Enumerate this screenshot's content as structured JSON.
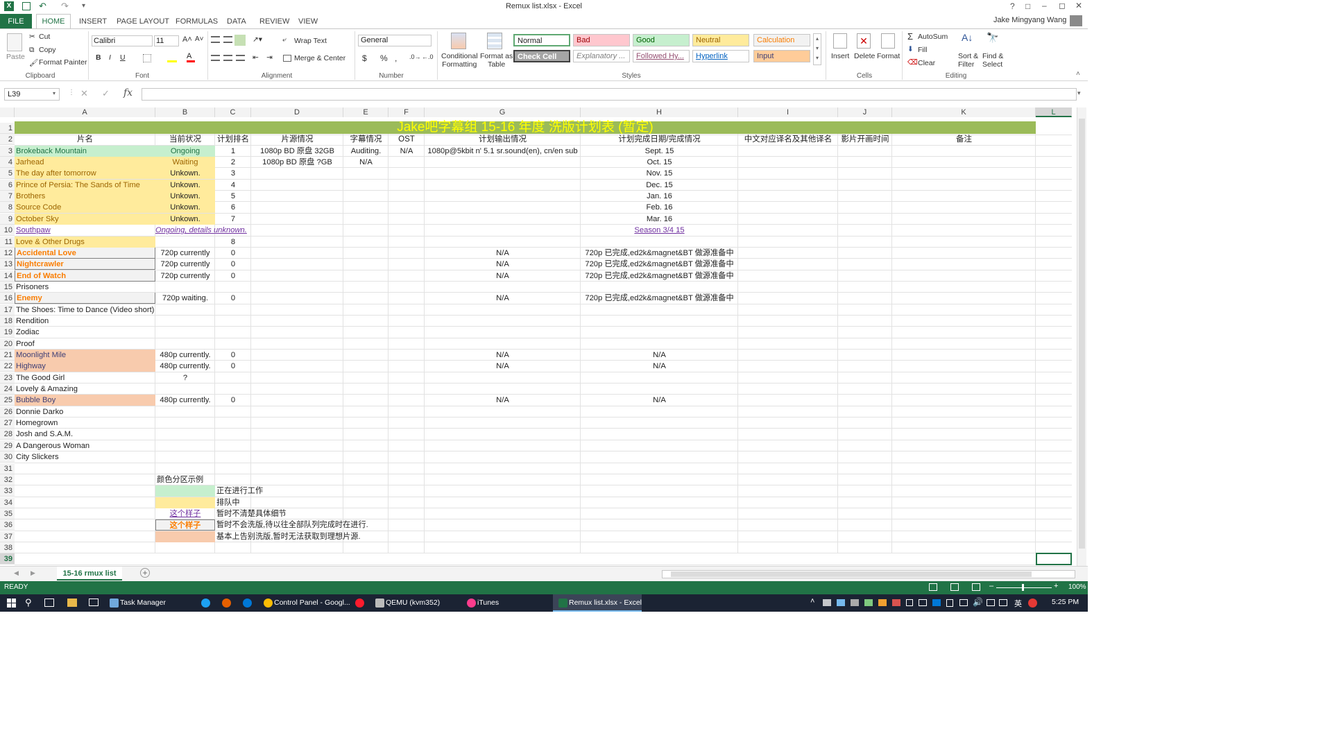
{
  "window": {
    "title": "Remux list.xlsx - Excel",
    "user": "Jake Mingyang Wang",
    "controls": [
      "?",
      "□",
      "–",
      "◻",
      "✕"
    ]
  },
  "tabs": [
    "FILE",
    "HOME",
    "INSERT",
    "PAGE LAYOUT",
    "FORMULAS",
    "DATA",
    "REVIEW",
    "VIEW"
  ],
  "ribbon": {
    "clipboard": {
      "paste": "Paste",
      "cut": "Cut",
      "copy": "Copy",
      "format_painter": "Format Painter",
      "group": "Clipboard"
    },
    "font": {
      "family": "Calibri",
      "size": "11",
      "bold": "B",
      "italic": "I",
      "underline": "U",
      "group": "Font"
    },
    "alignment": {
      "wrap": "Wrap Text",
      "merge": "Merge & Center",
      "group": "Alignment"
    },
    "number": {
      "format": "General",
      "currency": "$",
      "percent": "%",
      "comma": ",",
      "group": "Number"
    },
    "styles": {
      "conditional": "Conditional\nFormatting",
      "format_table": "Format as\nTable",
      "boxes": [
        {
          "label": "Normal",
          "bg": "#ffffff",
          "fg": "#222222"
        },
        {
          "label": "Bad",
          "bg": "#ffc7ce",
          "fg": "#9c0006"
        },
        {
          "label": "Good",
          "bg": "#c6efce",
          "fg": "#006100"
        },
        {
          "label": "Neutral",
          "bg": "#ffeb9c",
          "fg": "#9c6500"
        },
        {
          "label": "Calculation",
          "bg": "#f2f2f2",
          "fg": "#fa7d00"
        },
        {
          "label": "Check Cell",
          "bg": "#a5a5a5",
          "fg": "#ffffff"
        },
        {
          "label": "Explanatory ...",
          "bg": "#ffffff",
          "fg": "#7f7f7f"
        },
        {
          "label": "Followed Hy...",
          "bg": "#ffffff",
          "fg": "#954f72"
        },
        {
          "label": "Hyperlink",
          "bg": "#ffffff",
          "fg": "#0563c1"
        },
        {
          "label": "Input",
          "bg": "#ffcc99",
          "fg": "#3f3f76"
        }
      ],
      "group": "Styles"
    },
    "cells": {
      "insert": "Insert",
      "delete": "Delete",
      "format": "Format",
      "group": "Cells"
    },
    "editing": {
      "autosum": "AutoSum",
      "fill": "Fill",
      "clear": "Clear",
      "sort": "Sort &\nFilter",
      "find": "Find &\nSelect",
      "group": "Editing"
    }
  },
  "formula_bar": {
    "name_box": "L39",
    "fx": "fx",
    "value": ""
  },
  "columns": [
    "A",
    "B",
    "C",
    "D",
    "E",
    "F",
    "G",
    "H",
    "I",
    "J",
    "K",
    "L"
  ],
  "sheet": {
    "title": "Jake吧字幕组 15-16 年度 洗版计划表 (暂定)",
    "headers": [
      "片名",
      "当前状况",
      "计划排名",
      "片源情况",
      "字幕情况",
      "OST",
      "计划输出情况",
      "计划完成日期/完成情况",
      "中文对应译名及其他译名",
      "影片开画时间",
      "备注"
    ],
    "rows": [
      {
        "r": "3",
        "a": "Brokeback Mountain",
        "b": "Ongoing",
        "c": "1",
        "d": "1080p BD 原盘 32GB",
        "e": "Auditing.",
        "f": "N/A",
        "g": "1080p@5kbit n' 5.1 sr.sound(en), cn/en sub",
        "h": "Sept. 15"
      },
      {
        "r": "4",
        "a": "Jarhead",
        "b": "Waiting",
        "c": "2",
        "d": "1080p BD 原盘 ?GB",
        "e": "N/A",
        "f": "",
        "g": "",
        "h": "Oct. 15"
      },
      {
        "r": "5",
        "a": "The day after tomorrow",
        "b": "Unkown.",
        "c": "3",
        "d": "",
        "e": "",
        "f": "",
        "g": "",
        "h": "Nov. 15"
      },
      {
        "r": "6",
        "a": "Prince of Persia: The Sands of Time",
        "b": "Unkown.",
        "c": "4",
        "d": "",
        "e": "",
        "f": "",
        "g": "",
        "h": "Dec. 15"
      },
      {
        "r": "7",
        "a": "Brothers",
        "b": "Unkown.",
        "c": "5",
        "d": "",
        "e": "",
        "f": "",
        "g": "",
        "h": "Jan. 16"
      },
      {
        "r": "8",
        "a": "Source Code",
        "b": "Unkown.",
        "c": "6",
        "d": "",
        "e": "",
        "f": "",
        "g": "",
        "h": "Feb. 16"
      },
      {
        "r": "9",
        "a": "October Sky",
        "b": "Unkown.",
        "c": "7",
        "d": "",
        "e": "",
        "f": "",
        "g": "",
        "h": "Mar. 16"
      },
      {
        "r": "10",
        "a": "Southpaw",
        "b": "Ongoing, details unknown.",
        "c": "",
        "d": "",
        "e": "",
        "f": "",
        "g": "",
        "h": "Season 3/4 15"
      },
      {
        "r": "11",
        "a": "Love & Other Drugs",
        "b": "",
        "c": "8",
        "d": "",
        "e": "",
        "f": "",
        "g": "",
        "h": ""
      },
      {
        "r": "12",
        "a": "Accidental Love",
        "b": "720p currently",
        "c": "0",
        "d": "",
        "e": "",
        "f": "",
        "g": "N/A",
        "h": "720p 已完成,ed2k&magnet&BT 做源准备中"
      },
      {
        "r": "13",
        "a": "Nightcrawler",
        "b": "720p currently",
        "c": "0",
        "d": "",
        "e": "",
        "f": "",
        "g": "N/A",
        "h": "720p 已完成,ed2k&magnet&BT 做源准备中"
      },
      {
        "r": "14",
        "a": "End of Watch",
        "b": "720p currently",
        "c": "0",
        "d": "",
        "e": "",
        "f": "",
        "g": "N/A",
        "h": "720p 已完成,ed2k&magnet&BT 做源准备中"
      },
      {
        "r": "15",
        "a": "Prisoners",
        "b": "",
        "c": "",
        "d": "",
        "e": "",
        "f": "",
        "g": "",
        "h": ""
      },
      {
        "r": "16",
        "a": "Enemy",
        "b": "720p waiting.",
        "c": "0",
        "d": "",
        "e": "",
        "f": "",
        "g": "N/A",
        "h": "720p 已完成,ed2k&magnet&BT 做源准备中"
      },
      {
        "r": "17",
        "a": "The Shoes: Time to Dance (Video short)",
        "b": "",
        "c": "",
        "d": "",
        "e": "",
        "f": "",
        "g": "",
        "h": ""
      },
      {
        "r": "18",
        "a": "Rendition",
        "b": "",
        "c": "",
        "d": "",
        "e": "",
        "f": "",
        "g": "",
        "h": ""
      },
      {
        "r": "19",
        "a": "Zodiac",
        "b": "",
        "c": "",
        "d": "",
        "e": "",
        "f": "",
        "g": "",
        "h": ""
      },
      {
        "r": "20",
        "a": "Proof",
        "b": "",
        "c": "",
        "d": "",
        "e": "",
        "f": "",
        "g": "",
        "h": ""
      },
      {
        "r": "21",
        "a": "Moonlight Mile",
        "b": "480p currently.",
        "c": "0",
        "d": "",
        "e": "",
        "f": "",
        "g": "N/A",
        "h": "N/A"
      },
      {
        "r": "22",
        "a": "Highway",
        "b": "480p currently.",
        "c": "0",
        "d": "",
        "e": "",
        "f": "",
        "g": "N/A",
        "h": "N/A"
      },
      {
        "r": "23",
        "a": "The Good Girl",
        "b": "?",
        "c": "",
        "d": "",
        "e": "",
        "f": "",
        "g": "",
        "h": ""
      },
      {
        "r": "24",
        "a": "Lovely & Amazing",
        "b": "",
        "c": "",
        "d": "",
        "e": "",
        "f": "",
        "g": "",
        "h": ""
      },
      {
        "r": "25",
        "a": "Bubble Boy",
        "b": "480p currently.",
        "c": "0",
        "d": "",
        "e": "",
        "f": "",
        "g": "N/A",
        "h": "N/A"
      },
      {
        "r": "26",
        "a": "Donnie Darko",
        "b": "",
        "c": "",
        "d": "",
        "e": "",
        "f": "",
        "g": "",
        "h": ""
      },
      {
        "r": "27",
        "a": "Homegrown",
        "b": "",
        "c": "",
        "d": "",
        "e": "",
        "f": "",
        "g": "",
        "h": ""
      },
      {
        "r": "28",
        "a": "Josh and S.A.M.",
        "b": "",
        "c": "",
        "d": "",
        "e": "",
        "f": "",
        "g": "",
        "h": ""
      },
      {
        "r": "29",
        "a": "A Dangerous Woman",
        "b": "",
        "c": "",
        "d": "",
        "e": "",
        "f": "",
        "g": "",
        "h": ""
      },
      {
        "r": "30",
        "a": "City Slickers",
        "b": "",
        "c": "",
        "d": "",
        "e": "",
        "f": "",
        "g": "",
        "h": ""
      }
    ],
    "legend": {
      "title": "颜色分区示例",
      "items": [
        {
          "r": "33",
          "sample": "",
          "text": "正在进行工作"
        },
        {
          "r": "34",
          "sample": "",
          "text": "排队中"
        },
        {
          "r": "35",
          "sample": "这个样子",
          "text": "暂时不清楚具体细节"
        },
        {
          "r": "36",
          "sample": "这个样子",
          "text": "暂时不会洗版,待以往全部队列完成时在进行."
        },
        {
          "r": "37",
          "sample": "",
          "text": "基本上告别洗版,暂时无法获取到理想片源."
        }
      ]
    },
    "extra_rows": [
      "31",
      "32",
      "38",
      "39"
    ]
  },
  "colors": {
    "green": "#c6efce",
    "yellow": "#ffeb9c",
    "orange": "#f8cbad",
    "gray": "#f2f2f2",
    "title_bg": "#9bbb59",
    "title_fg": "#ffff00",
    "excel_green": "#217346"
  },
  "sheet_tab": "15-16 rmux list",
  "status": {
    "left": "READY",
    "zoom": "100%"
  },
  "taskbar": {
    "items": [
      "Task Manager",
      "Control Panel - Googl...",
      "QEMU (kvm352)",
      "iTunes",
      "Remux list.xlsx - Excel"
    ],
    "time": "5:25 PM",
    "ime": "英"
  }
}
